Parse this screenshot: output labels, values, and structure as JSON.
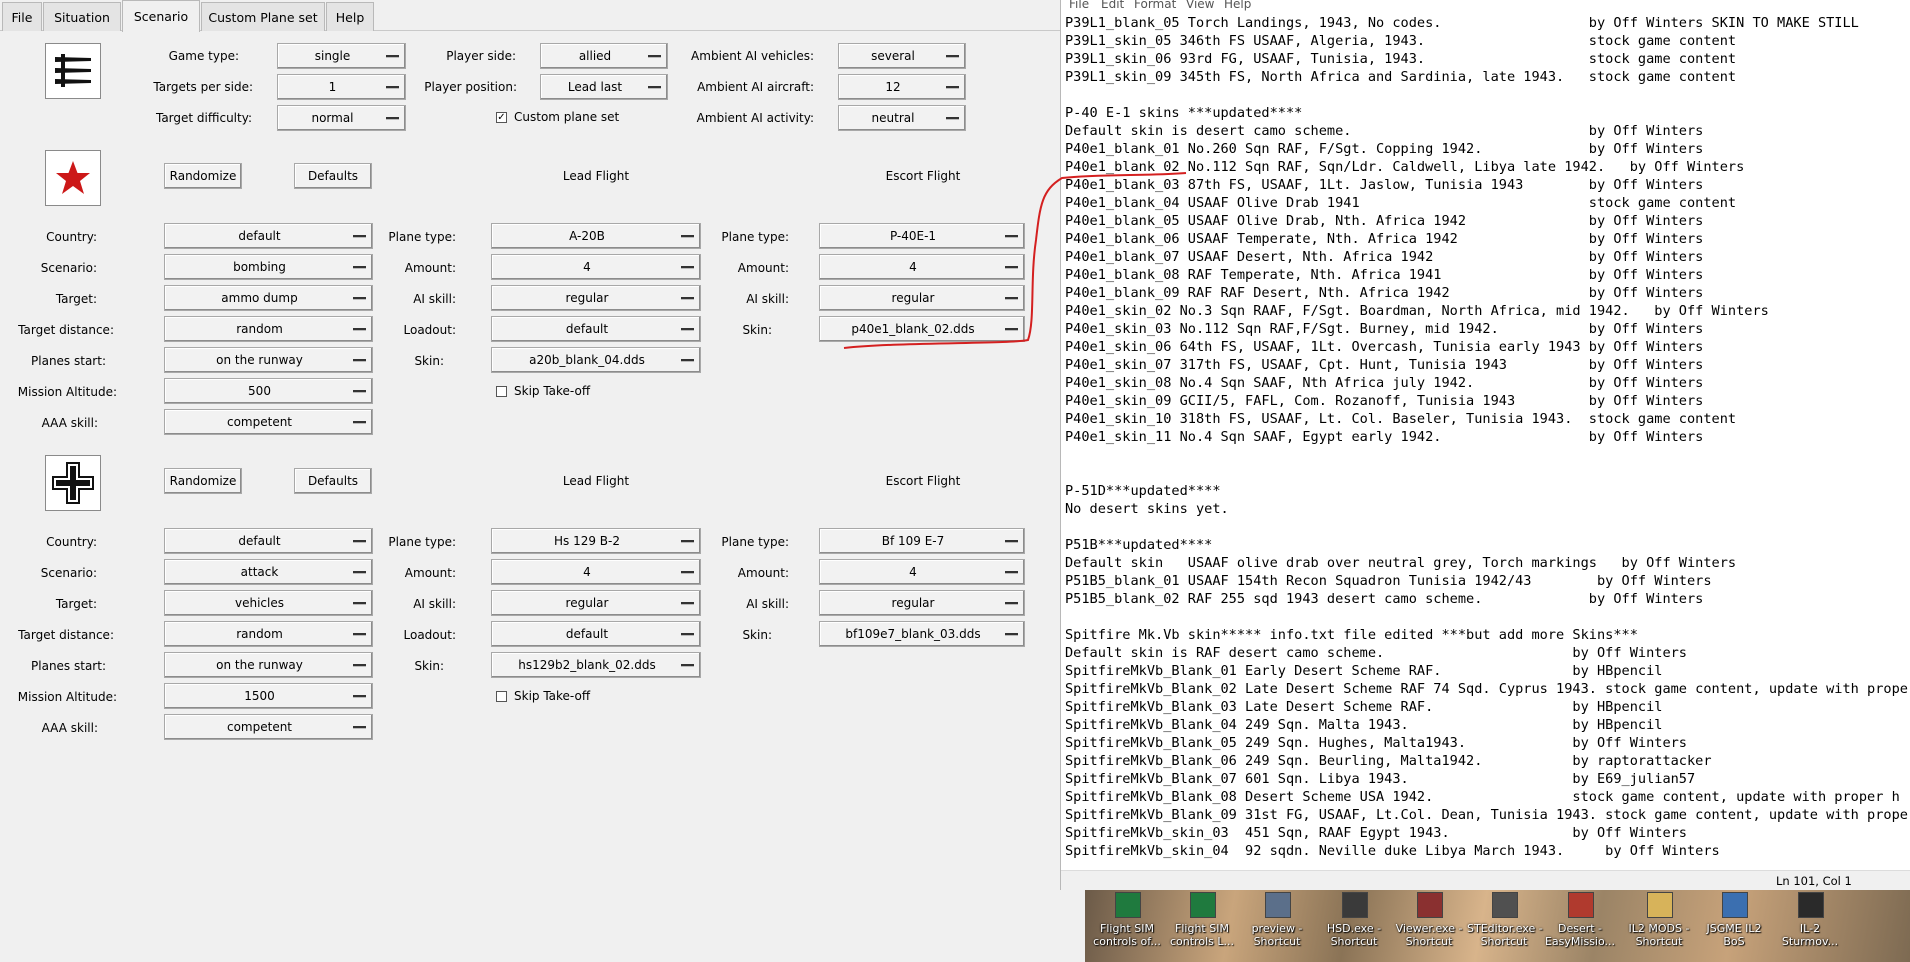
{
  "tabs": [
    "File",
    "Situation",
    "Scenario",
    "Custom Plane set",
    "Help"
  ],
  "general": {
    "game_type_label": "Game type:",
    "game_type": "single",
    "targets_per_side_label": "Targets per side:",
    "targets_per_side": "1",
    "target_difficulty_label": "Target difficulty:",
    "target_difficulty": "normal",
    "player_side_label": "Player side:",
    "player_side": "allied",
    "player_position_label": "Player position:",
    "player_position": "Lead last",
    "custom_plane_set_label": "Custom plane set",
    "custom_plane_set_checked": true,
    "ambient_vehicles_label": "Ambient AI vehicles:",
    "ambient_vehicles": "several",
    "ambient_aircraft_label": "Ambient AI aircraft:",
    "ambient_aircraft": "12",
    "ambient_activity_label": "Ambient AI activity:",
    "ambient_activity": "neutral"
  },
  "side1": {
    "randomize": "Randomize",
    "defaults": "Defaults",
    "lead_flight": "Lead Flight",
    "escort_flight": "Escort Flight",
    "country_label": "Country:",
    "country": "default",
    "scenario_label": "Scenario:",
    "scenario": "bombing",
    "target_label": "Target:",
    "target": "ammo dump",
    "target_distance_label": "Target distance:",
    "target_distance": "random",
    "planes_start_label": "Planes start:",
    "planes_start": "on the runway",
    "mission_altitude_label": "Mission Altitude:",
    "mission_altitude": "500",
    "aaa_skill_label": "AAA skill:",
    "aaa_skill": "competent",
    "lead_plane_type_label": "Plane type:",
    "lead_plane_type": "A-20B",
    "lead_amount_label": "Amount:",
    "lead_amount": "4",
    "lead_ai_skill_label": "AI skill:",
    "lead_ai_skill": "regular",
    "lead_loadout_label": "Loadout:",
    "lead_loadout": "default",
    "lead_skin_label": "Skin:",
    "lead_skin": "a20b_blank_04.dds",
    "skip_takeoff_label": "Skip Take-off",
    "escort_plane_type_label": "Plane type:",
    "escort_plane_type": "P-40E-1",
    "escort_amount_label": "Amount:",
    "escort_amount": "4",
    "escort_ai_skill_label": "AI skill:",
    "escort_ai_skill": "regular",
    "escort_skin_label": "Skin:",
    "escort_skin": "p40e1_blank_02.dds"
  },
  "side2": {
    "randomize": "Randomize",
    "defaults": "Defaults",
    "lead_flight": "Lead Flight",
    "escort_flight": "Escort Flight",
    "country_label": "Country:",
    "country": "default",
    "scenario_label": "Scenario:",
    "scenario": "attack",
    "target_label": "Target:",
    "target": "vehicles",
    "target_distance_label": "Target distance:",
    "target_distance": "random",
    "planes_start_label": "Planes start:",
    "planes_start": "on the runway",
    "mission_altitude_label": "Mission Altitude:",
    "mission_altitude": "1500",
    "aaa_skill_label": "AAA skill:",
    "aaa_skill": "competent",
    "lead_plane_type_label": "Plane type:",
    "lead_plane_type": "Hs 129 B-2",
    "lead_amount_label": "Amount:",
    "lead_amount": "4",
    "lead_ai_skill_label": "AI skill:",
    "lead_ai_skill": "regular",
    "lead_loadout_label": "Loadout:",
    "lead_loadout": "default",
    "lead_skin_label": "Skin:",
    "lead_skin": "hs129b2_blank_02.dds",
    "skip_takeoff_label": "Skip Take-off",
    "escort_plane_type_label": "Plane type:",
    "escort_plane_type": "Bf 109 E-7",
    "escort_amount_label": "Amount:",
    "escort_amount": "4",
    "escort_ai_skill_label": "AI skill:",
    "escort_ai_skill": "regular",
    "escort_skin_label": "Skin:",
    "escort_skin": "bf109e7_blank_03.dds"
  },
  "notepad": {
    "menu": [
      "File",
      "Edit",
      "Format",
      "View",
      "Help"
    ],
    "status": "Ln 101, Col 1",
    "lines": [
      "P39L1_blank_05 Torch Landings, 1943, No codes.                  by Off Winters SKIN TO MAKE STILL",
      "P39L1_skin_05 346th FS USAAF, Algeria, 1943.                    stock game content",
      "P39L1_skin_06 93rd FG, USAAF, Tunisia, 1943.                    stock game content",
      "P39L1_skin_09 345th FS, North Africa and Sardinia, late 1943.   stock game content",
      "",
      "P-40 E-1 skins ***updated****",
      "Default skin is desert camo scheme.                             by Off Winters",
      "P40e1_blank_01 No.260 Sqn RAF, F/Sgt. Copping 1942.             by Off Winters",
      "P40e1_blank_02 No.112 Sqn RAF, Sqn/Ldr. Caldwell, Libya late 1942.   by Off Winters",
      "P40e1_blank_03 87th FS, USAAF, 1Lt. Jaslow, Tunisia 1943        by Off Winters",
      "P40e1_blank_04 USAAF Olive Drab 1941                            stock game content",
      "P40e1_blank_05 USAAF Olive Drab, Nth. Africa 1942               by Off Winters",
      "P40e1_blank_06 USAAF Temperate, Nth. Africa 1942                by Off Winters",
      "P40e1_blank_07 USAAF Desert, Nth. Africa 1942                   by Off Winters",
      "P40e1_blank_08 RAF Temperate, Nth. Africa 1941                  by Off Winters",
      "P40e1_blank_09 RAF RAF Desert, Nth. Africa 1942                 by Off Winters",
      "P40e1_skin_02 No.3 Sqn RAAF, F/Sgt. Boardman, North Africa, mid 1942.   by Off Winters",
      "P40e1_skin_03 No.112 Sqn RAF,F/Sgt. Burney, mid 1942.           by Off Winters",
      "P40e1_skin_06 64th FS, USAAF, 1Lt. Overcash, Tunisia early 1943 by Off Winters",
      "P40e1_skin_07 317th FS, USAAF, Cpt. Hunt, Tunisia 1943          by Off Winters",
      "P40e1_skin_08 No.4 Sqn SAAF, Nth Africa july 1942.              by Off Winters",
      "P40e1_skin_09 GCII/5, FAFL, Com. Rozanoff, Tunisia 1943         by Off Winters",
      "P40e1_skin_10 318th FS, USAAF, Lt. Col. Baseler, Tunisia 1943.  stock game content",
      "P40e1_skin_11 No.4 Sqn SAAF, Egypt early 1942.                  by Off Winters",
      "",
      "",
      "P-51D***updated****",
      "No desert skins yet.",
      "",
      "P51B***updated****",
      "Default skin   USAAF olive drab over neutral grey, Torch markings   by Off Winters",
      "P51B5_blank_01 USAAF 154th Recon Squadron Tunisia 1942/43        by Off Winters",
      "P51B5_blank_02 RAF 255 sqd 1943 desert camo scheme.             by Off Winters",
      "",
      "Spitfire Mk.Vb skin***** info.txt file edited ***but add more Skins***",
      "Default skin is RAF desert camo scheme.                       by Off Winters",
      "SpitfireMkVb_Blank_01 Early Desert Scheme RAF.                by HBpencil",
      "SpitfireMkVb_Blank_02 Late Desert Scheme RAF 74 Sqd. Cyprus 1943. stock game content, update with proper h",
      "SpitfireMkVb_Blank_03 Late Desert Scheme RAF.                 by HBpencil",
      "SpitfireMkVb_Blank_04 249 Sqn. Malta 1943.                    by HBpencil",
      "SpitfireMkVb_Blank_05 249 Sqn. Hughes, Malta1943.             by Off Winters",
      "SpitfireMkVb_Blank_06 249 Sqn. Beurling, Malta1942.           by raptorattacker",
      "SpitfireMkVb_Blank_07 601 Sqn. Libya 1943.                    by E69_julian57",
      "SpitfireMkVb_Blank_08 Desert Scheme USA 1942.                 stock game content, update with proper h",
      "SpitfireMkVb_Blank_09 31st FG, USAAF, Lt.Col. Dean, Tunisia 1943. stock game content, update with proper h",
      "SpitfireMkVb_skin_03  451 Sqn, RAAF Egypt 1943.               by Off Winters",
      "SpitfireMkVb_skin_04  92 sqdn. Neville duke Libya March 1943.     by Off Winters"
    ]
  },
  "desktop_icons": [
    "Flight SIM\ncontrols of...",
    "Flight SIM\ncontrols L...",
    "preview -\nShortcut",
    "HSD.exe -\nShortcut",
    "Viewer.exe -\nShortcut",
    "STEditor.exe -\nShortcut",
    "Desert -\nEasyMissio...",
    "IL2 MODS -\nShortcut",
    "JSGME IL2\nBoS",
    "IL-2\nSturmov..."
  ],
  "colors": {
    "annotation": "#d42020",
    "star_red": "#cc1818"
  }
}
